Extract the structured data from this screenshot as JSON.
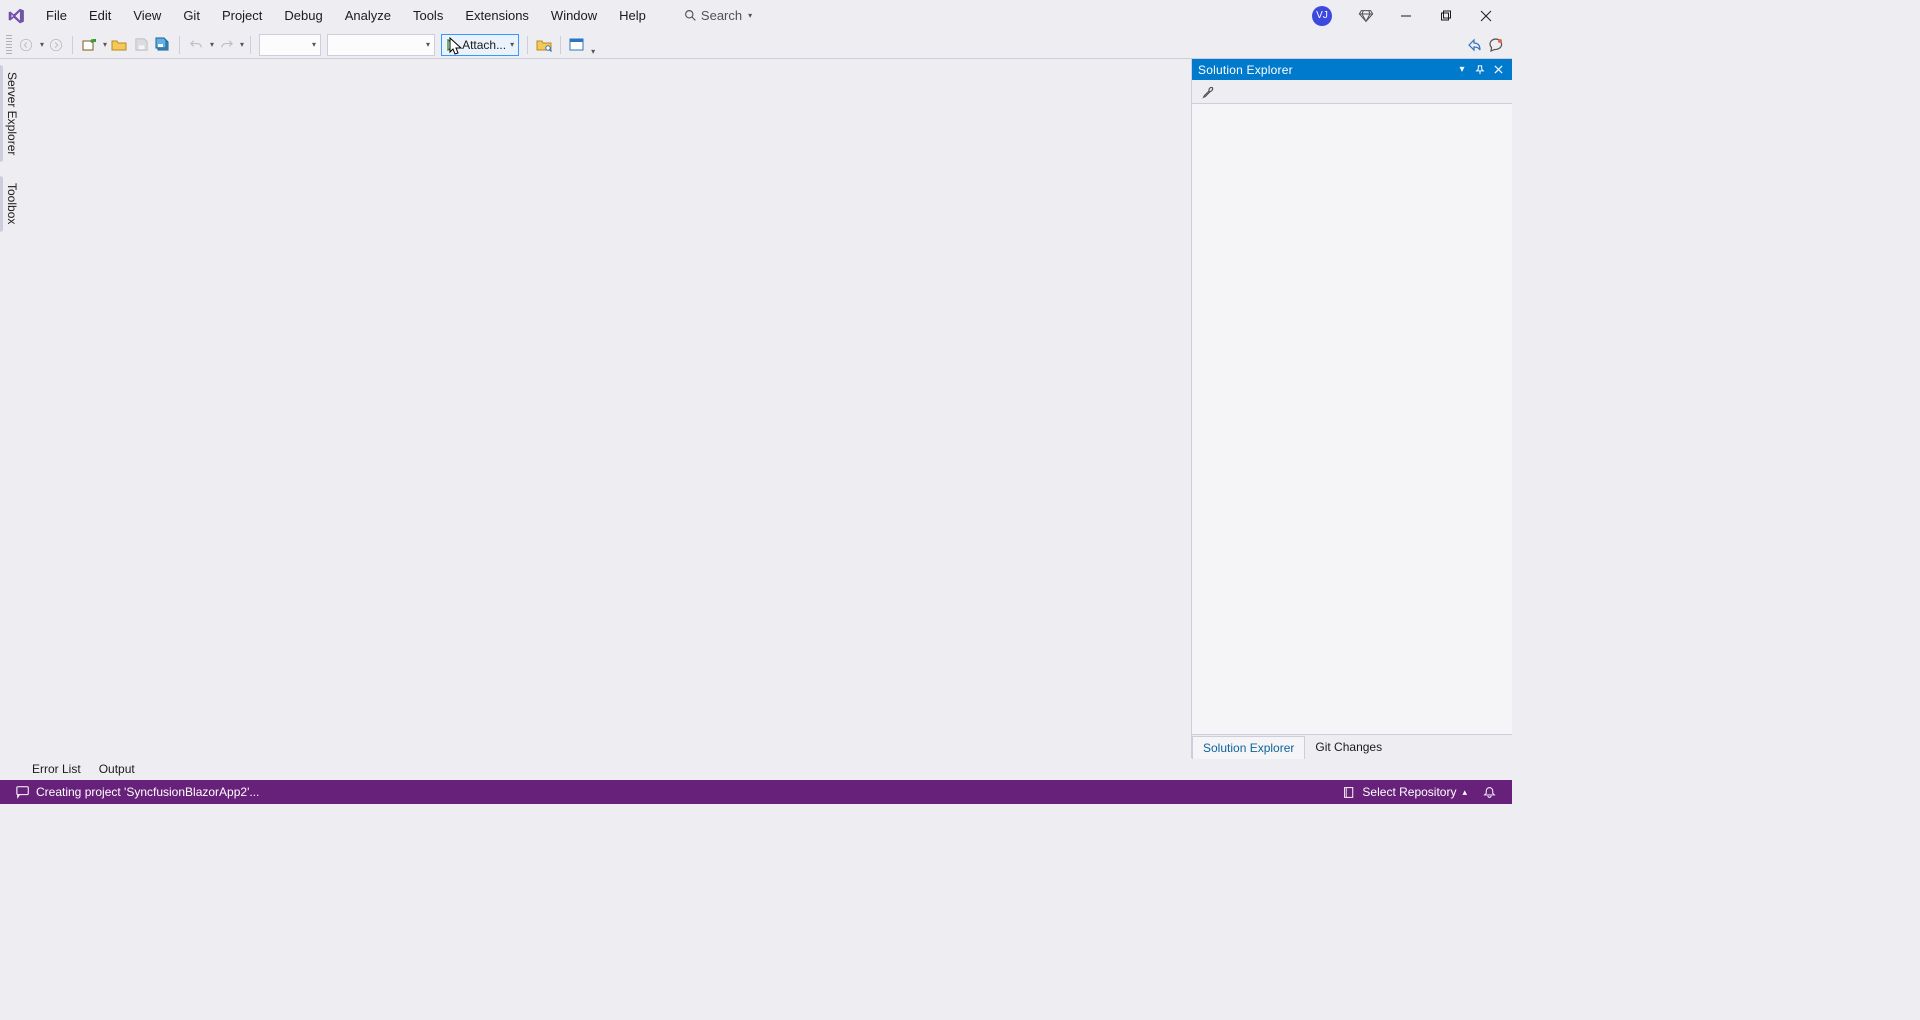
{
  "menubar": {
    "items": [
      "File",
      "Edit",
      "View",
      "Git",
      "Project",
      "Debug",
      "Analyze",
      "Tools",
      "Extensions",
      "Window",
      "Help"
    ],
    "search_label": "Search",
    "user_initials": "VJ"
  },
  "toolbar": {
    "attach_label": "Attach..."
  },
  "left_tabs": {
    "server_explorer": "Server Explorer",
    "toolbox": "Toolbox"
  },
  "solution_explorer": {
    "title": "Solution Explorer",
    "tabs": {
      "solution_explorer": "Solution Explorer",
      "git_changes": "Git Changes"
    }
  },
  "bottom_tabs": {
    "error_list": "Error List",
    "output": "Output"
  },
  "statusbar": {
    "message": "Creating project 'SyncfusionBlazorApp2'...",
    "repository": "Select Repository"
  }
}
